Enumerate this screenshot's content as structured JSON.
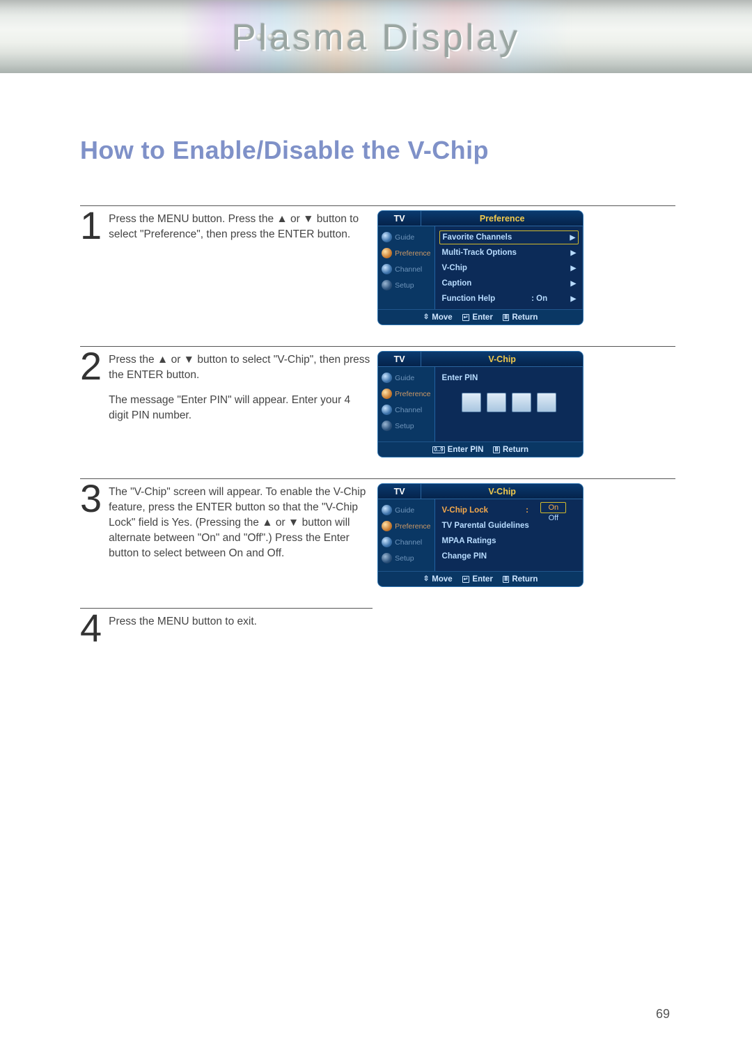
{
  "banner": {
    "title": "Plasma Display"
  },
  "page": {
    "title": "How to Enable/Disable the V-Chip",
    "number": "69"
  },
  "steps": [
    {
      "num": "1",
      "paragraphs": [
        "Press the MENU button. Press the ▲ or ▼ button to select \"Preference\", then press the ENTER button."
      ]
    },
    {
      "num": "2",
      "paragraphs": [
        "Press the ▲ or ▼ button to select \"V-Chip\", then press the ENTER button.",
        "The message \"Enter PIN\" will appear. Enter your 4 digit PIN number."
      ]
    },
    {
      "num": "3",
      "paragraphs": [
        "The \"V-Chip\" screen will appear. To enable the V-Chip feature, press the ENTER button so that the \"V-Chip Lock\" field is Yes. (Pressing the ▲ or ▼ button will alternate between \"On\" and \"Off\".) Press the Enter button to select between On and Off."
      ]
    },
    {
      "num": "4",
      "paragraphs": [
        "Press the MENU button to exit."
      ]
    }
  ],
  "osd": {
    "tv_label": "TV",
    "side_items": [
      "Guide",
      "Preference",
      "Channel",
      "Setup"
    ],
    "footer_move": "Move",
    "footer_enter": "Enter",
    "footer_return": "Return",
    "footer_enterpin": "Enter PIN",
    "screen1": {
      "title": "Preference",
      "rows": [
        {
          "label": "Favorite Channels",
          "value": "",
          "hl": true
        },
        {
          "label": "Multi-Track Options",
          "value": ""
        },
        {
          "label": "V-Chip",
          "value": ""
        },
        {
          "label": "Caption",
          "value": ""
        },
        {
          "label": "Function Help",
          "value": ": On"
        }
      ]
    },
    "screen2": {
      "title": "V-Chip",
      "enter_pin_label": "Enter PIN"
    },
    "screen3": {
      "title": "V-Chip",
      "rows": [
        {
          "label": "V-Chip Lock",
          "value": ":"
        },
        {
          "label": "TV Parental Guidelines",
          "value": ""
        },
        {
          "label": "MPAA Ratings",
          "value": ""
        },
        {
          "label": "Change PIN",
          "value": ""
        }
      ],
      "opt_on": "On",
      "opt_off": "Off"
    }
  }
}
